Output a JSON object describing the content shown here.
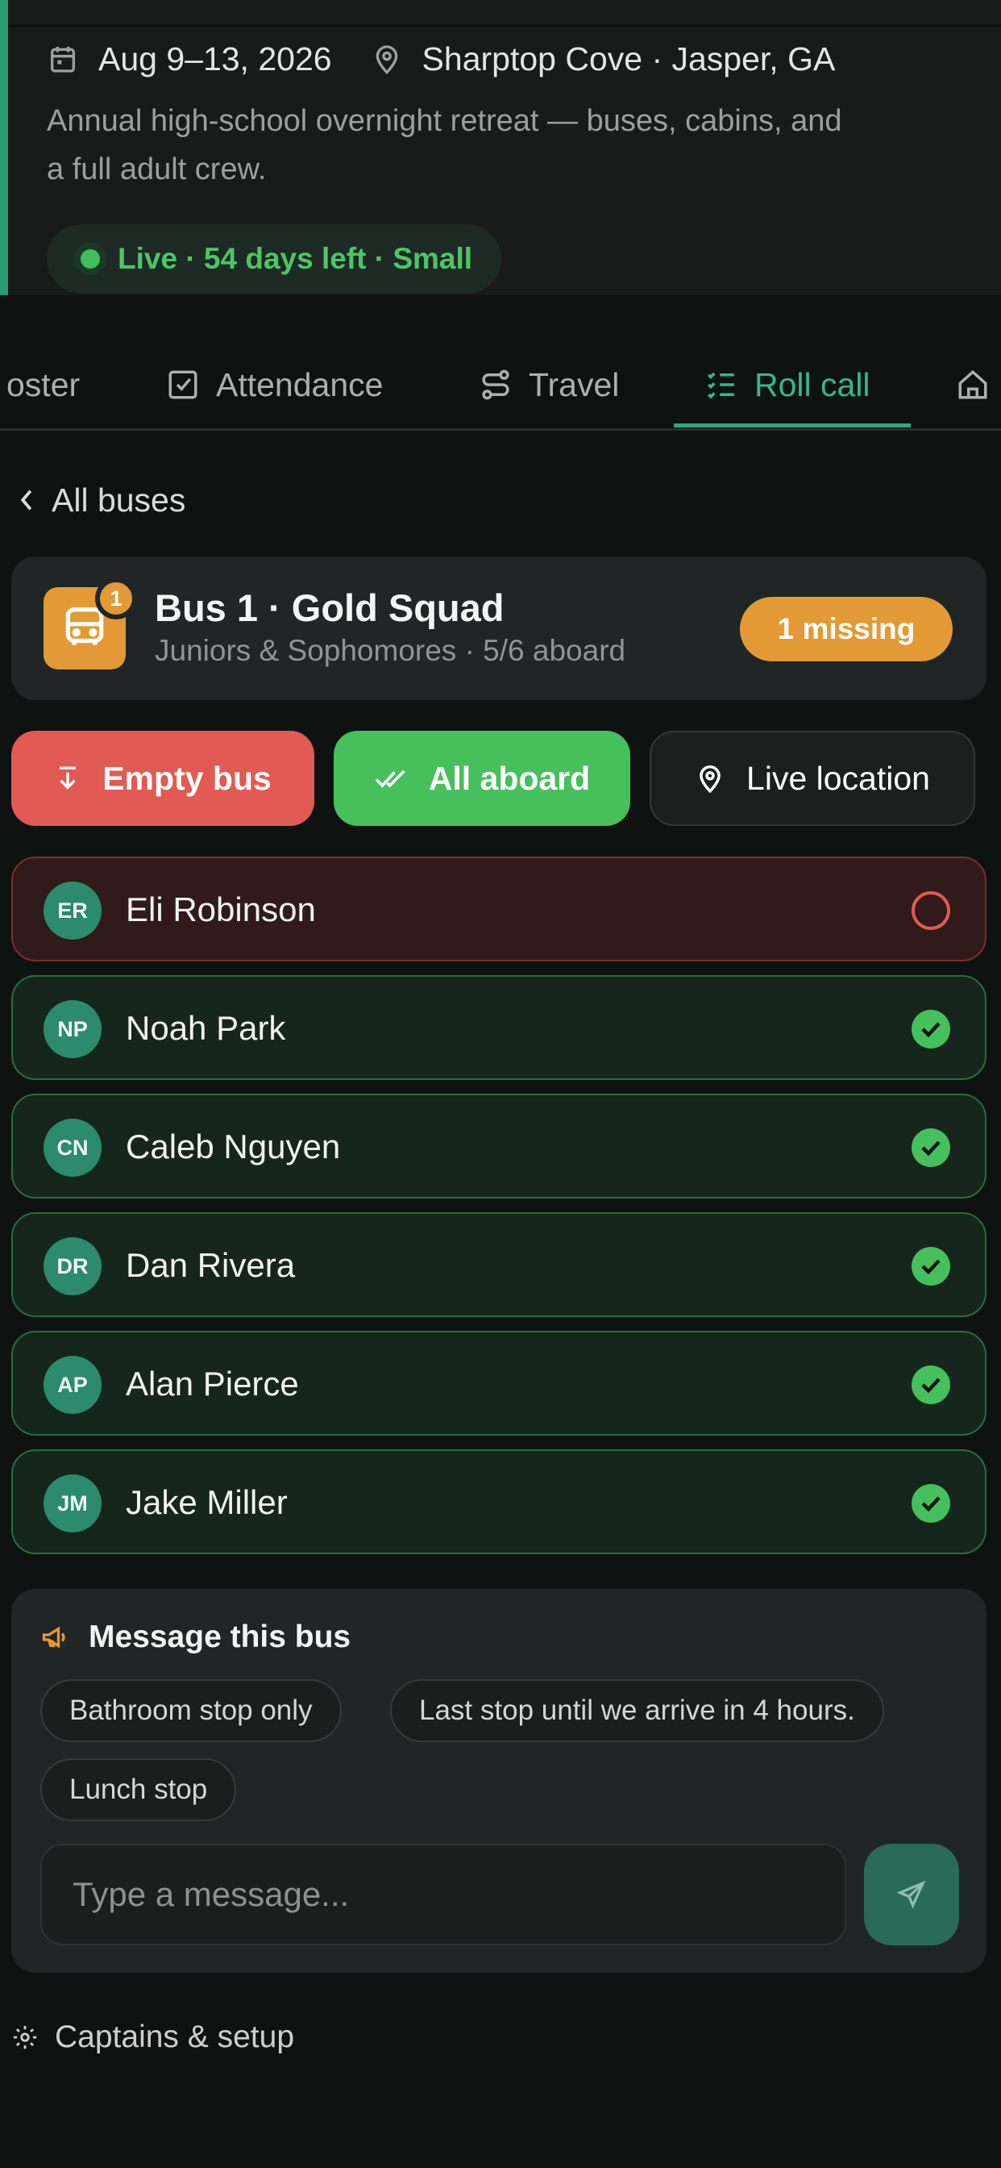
{
  "event": {
    "date": "Aug 9–13, 2026",
    "location": "Sharptop Cove · Jasper, GA",
    "description_line1": "Annual high-school overnight retreat — buses, cabins, and",
    "description_line2": "a full adult crew.",
    "status": "Live · 54 days left · Small"
  },
  "tabs": {
    "roster": "oster",
    "attendance": "Attendance",
    "travel": "Travel",
    "rollcall": "Roll call",
    "active": "Roll call"
  },
  "back_label": "All buses",
  "bus": {
    "badge_count": "1",
    "title": "Bus 1 · Gold Squad",
    "subtitle": "Juniors & Sophomores · 5/6 aboard",
    "missing_label": "1 missing"
  },
  "actions": {
    "empty_bus": "Empty bus",
    "all_aboard": "All aboard",
    "live_location": "Live location"
  },
  "riders": [
    {
      "initials": "ER",
      "name": "Eli Robinson",
      "aboard": false
    },
    {
      "initials": "NP",
      "name": "Noah Park",
      "aboard": true
    },
    {
      "initials": "CN",
      "name": "Caleb Nguyen",
      "aboard": true
    },
    {
      "initials": "DR",
      "name": "Dan Rivera",
      "aboard": true
    },
    {
      "initials": "AP",
      "name": "Alan Pierce",
      "aboard": true
    },
    {
      "initials": "JM",
      "name": "Jake Miller",
      "aboard": true
    }
  ],
  "message": {
    "heading": "Message this bus",
    "quick_replies": [
      "Bathroom stop only",
      "Last stop until we arrive in 4 hours.",
      "Lunch stop"
    ],
    "placeholder": "Type a message..."
  },
  "footer_link": "Captains & setup",
  "colors": {
    "accent": "#2fa77e",
    "missing": "#e15a53",
    "aboard": "#46c05c",
    "warning": "#e39a36"
  }
}
